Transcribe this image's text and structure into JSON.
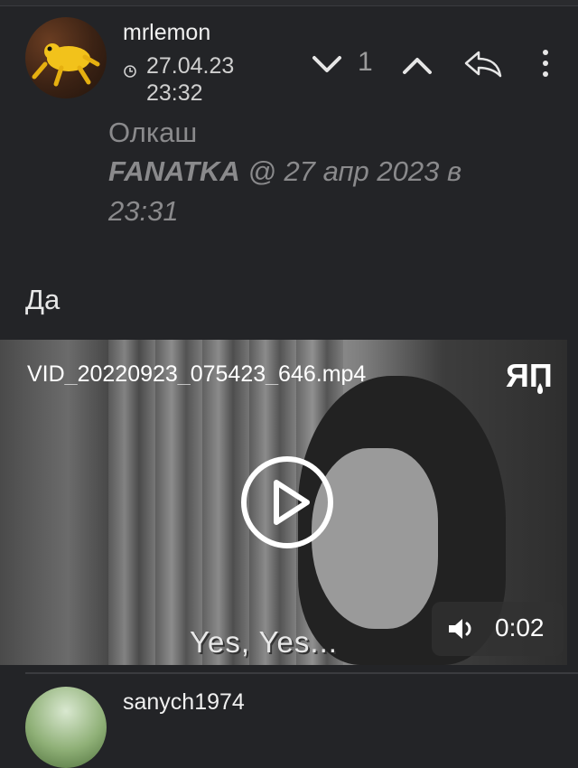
{
  "post": {
    "username": "mrlemon",
    "date": "27.04.23 23:32",
    "score": "1",
    "quote": {
      "title": "Олкаш",
      "author": "FANATKA",
      "meta": " @ 27 апр 2023 в 23:31"
    },
    "message": "Да",
    "video": {
      "file_name": "VID_20220923_075423_646.mp4",
      "subtitle": "Yes, Yes...",
      "duration": "0:02",
      "logo_text": "ЯП"
    }
  },
  "next_post": {
    "username": "sanych1974"
  },
  "icons": {
    "clock": "clock-icon",
    "down": "chevron-down-icon",
    "up": "chevron-up-icon",
    "reply": "reply-icon",
    "more": "more-vertical-icon",
    "play": "play-icon",
    "volume": "volume-icon"
  },
  "colors": {
    "background": "#232427",
    "muted_text": "#8a8a8c",
    "accent_frog": "#f2c21b"
  }
}
